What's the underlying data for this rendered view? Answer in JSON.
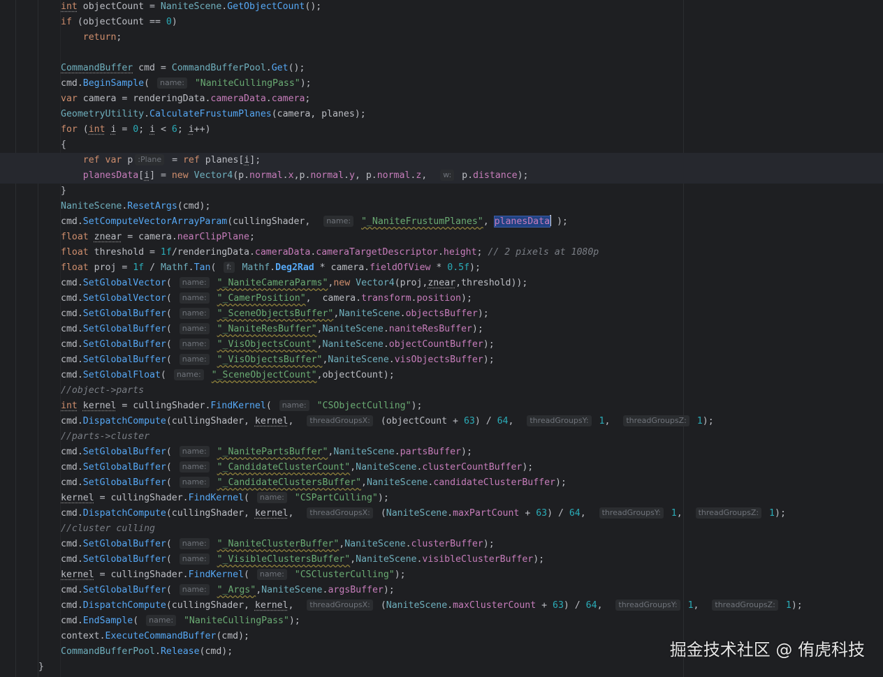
{
  "editor": {
    "lines": [
      {
        "t": "int objectCount = NaniteScene.GetObjectCount();"
      },
      {
        "t": "if (objectCount == 0)"
      },
      {
        "t": "    return;"
      },
      {
        "t": ""
      },
      {
        "t": "CommandBuffer cmd = CommandBufferPool.Get();"
      },
      {
        "t": "cmd.BeginSample( name: \"NaniteCullingPass\");"
      },
      {
        "t": "var camera = renderingData.cameraData.camera;"
      },
      {
        "t": "GeometryUtility.CalculateFrustumPlanes(camera, planes);"
      },
      {
        "t": "for (int i = 0; i < 6; i++)"
      },
      {
        "t": "{"
      },
      {
        "t": "    ref var p :Plane = ref planes[i];"
      },
      {
        "t": "    planesData[i] = new Vector4(p.normal.x,p.normal.y, p.normal.z,  w: p.distance);"
      },
      {
        "t": "}"
      },
      {
        "t": "NaniteScene.ResetArgs(cmd);"
      },
      {
        "t": "cmd.SetComputeVectorArrayParam(cullingShader,  name: \"_NaniteFrustumPlanes\", planesData );"
      },
      {
        "t": "float znear = camera.nearClipPlane;"
      },
      {
        "t": "float threshold = 1f/renderingData.cameraData.cameraTargetDescriptor.height; // 2 pixels at 1080p"
      },
      {
        "t": "float proj = 1f / Mathf.Tan( f: Mathf.Deg2Rad * camera.fieldOfView * 0.5f);"
      },
      {
        "t": "cmd.SetGlobalVector( name: \"_NaniteCameraParms\",new Vector4(proj,znear,threshold));"
      },
      {
        "t": "cmd.SetGlobalVector( name: \"_CamerPosition\",  camera.transform.position);"
      },
      {
        "t": "cmd.SetGlobalBuffer( name: \"_SceneObjectsBuffer\",NaniteScene.objectsBuffer);"
      },
      {
        "t": "cmd.SetGlobalBuffer( name: \"_NaniteResBuffer\",NaniteScene.naniteResBuffer);"
      },
      {
        "t": "cmd.SetGlobalBuffer( name: \"_VisObjectsCount\",NaniteScene.objectCountBuffer);"
      },
      {
        "t": "cmd.SetGlobalBuffer( name: \"_VisObjectsBuffer\",NaniteScene.visObjectsBuffer);"
      },
      {
        "t": "cmd.SetGlobalFloat( name: \"_SceneObjectCount\",objectCount);"
      },
      {
        "t": "//object->parts"
      },
      {
        "t": "int kernel = cullingShader.FindKernel( name: \"CSObjectCulling\");"
      },
      {
        "t": "cmd.DispatchCompute(cullingShader, kernel,  threadGroupsX: (objectCount + 63) / 64,  threadGroupsY: 1,  threadGroupsZ: 1);"
      },
      {
        "t": "//parts->cluster"
      },
      {
        "t": "cmd.SetGlobalBuffer( name: \"_NanitePartsBuffer\",NaniteScene.partsBuffer);"
      },
      {
        "t": "cmd.SetGlobalBuffer( name: \"_CandidateClusterCount\",NaniteScene.clusterCountBuffer);"
      },
      {
        "t": "cmd.SetGlobalBuffer( name: \"_CandidateClustersBuffer\",NaniteScene.candidateClusterBuffer);"
      },
      {
        "t": "kernel = cullingShader.FindKernel( name: \"CSPartCulling\");"
      },
      {
        "t": "cmd.DispatchCompute(cullingShader, kernel,  threadGroupsX: (NaniteScene.maxPartCount + 63) / 64,  threadGroupsY: 1,  threadGroupsZ: 1);"
      },
      {
        "t": "//cluster culling"
      },
      {
        "t": "cmd.SetGlobalBuffer( name: \"_NaniteClusterBuffer\",NaniteScene.clusterBuffer);"
      },
      {
        "t": "cmd.SetGlobalBuffer( name: \"_VisibleClustersBuffer\",NaniteScene.visibleClusterBuffer);"
      },
      {
        "t": "kernel = cullingShader.FindKernel( name: \"CSClusterCulling\");"
      },
      {
        "t": "cmd.SetGlobalBuffer( name: \"_Args\",NaniteScene.argsBuffer);"
      },
      {
        "t": "cmd.DispatchCompute(cullingShader, kernel,  threadGroupsX: (NaniteScene.maxClusterCount + 63) / 64,  threadGroupsY: 1,  threadGroupsZ: 1);"
      },
      {
        "t": "cmd.EndSample( name: \"NaniteCullingPass\");"
      },
      {
        "t": "context.ExecuteCommandBuffer(cmd);"
      },
      {
        "t": "CommandBufferPool.Release(cmd);"
      },
      {
        "t": "}"
      }
    ]
  },
  "watermark": "掘金技术社区 @ 侑虎科技",
  "colors": {
    "background": "#1e1f22",
    "keyword": "#cf8e6d",
    "string": "#6aab73",
    "number": "#2aacb8",
    "method": "#56a8f5",
    "field": "#c77dbb",
    "comment": "#7a7e85",
    "selection": "#214283"
  }
}
